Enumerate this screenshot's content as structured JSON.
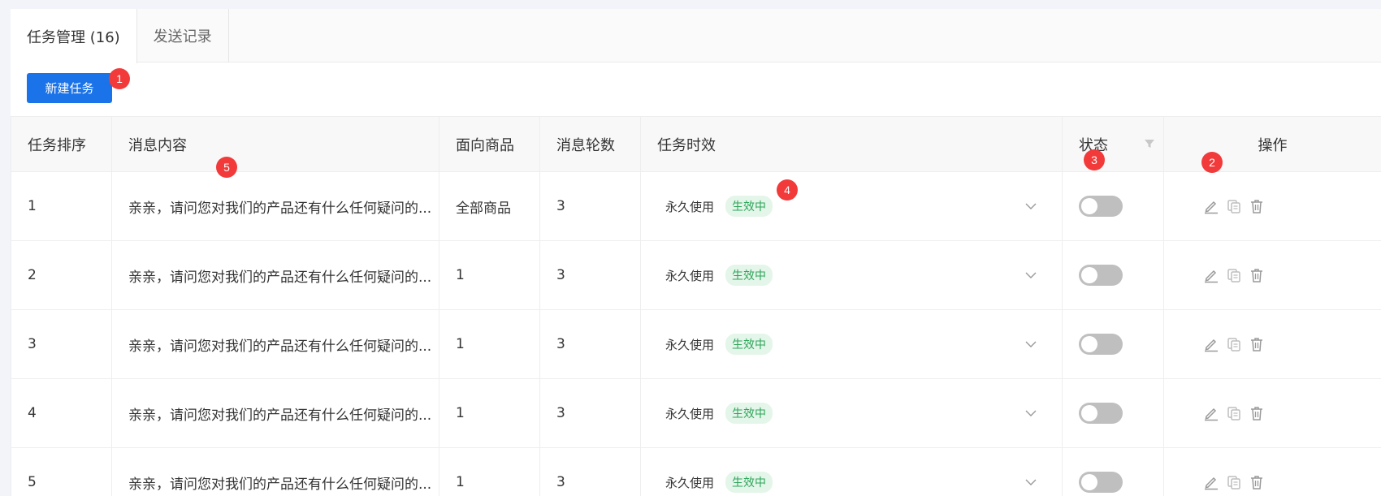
{
  "tabs": [
    {
      "label": "任务管理 (16)",
      "active": true
    },
    {
      "label": "发送记录",
      "active": false
    }
  ],
  "toolbar": {
    "new_task_label": "新建任务"
  },
  "markers": [
    "1",
    "2",
    "3",
    "4",
    "5"
  ],
  "table": {
    "headers": [
      "任务排序",
      "消息内容",
      "面向商品",
      "消息轮数",
      "任务时效",
      "状态",
      "操作"
    ],
    "rows": [
      {
        "order": "1",
        "content": "亲亲，请问您对我们的产品还有什么任何疑问的...",
        "product": "全部商品",
        "rounds": "3",
        "validity": "永久使用",
        "tag": "生效中",
        "enabled": false
      },
      {
        "order": "2",
        "content": "亲亲，请问您对我们的产品还有什么任何疑问的...",
        "product": "1",
        "rounds": "3",
        "validity": "永久使用",
        "tag": "生效中",
        "enabled": false
      },
      {
        "order": "3",
        "content": "亲亲，请问您对我们的产品还有什么任何疑问的...",
        "product": "1",
        "rounds": "3",
        "validity": "永久使用",
        "tag": "生效中",
        "enabled": false
      },
      {
        "order": "4",
        "content": "亲亲，请问您对我们的产品还有什么任何疑问的...",
        "product": "1",
        "rounds": "3",
        "validity": "永久使用",
        "tag": "生效中",
        "enabled": false
      },
      {
        "order": "5",
        "content": "亲亲，请问您对我们的产品还有什么任何疑问的...",
        "product": "1",
        "rounds": "3",
        "validity": "永久使用",
        "tag": "生效中",
        "enabled": false
      }
    ]
  },
  "icons": {
    "filter": "filter-icon",
    "expand": "chevron-down-icon",
    "edit": "edit-icon",
    "copy": "copy-icon",
    "delete": "trash-icon"
  },
  "colors": {
    "primary": "#1a73e8",
    "marker": "#f23a3a",
    "tag_bg": "#e4f5e9",
    "tag_text": "#2fa55a",
    "toggle_off": "#bfbfbf"
  }
}
